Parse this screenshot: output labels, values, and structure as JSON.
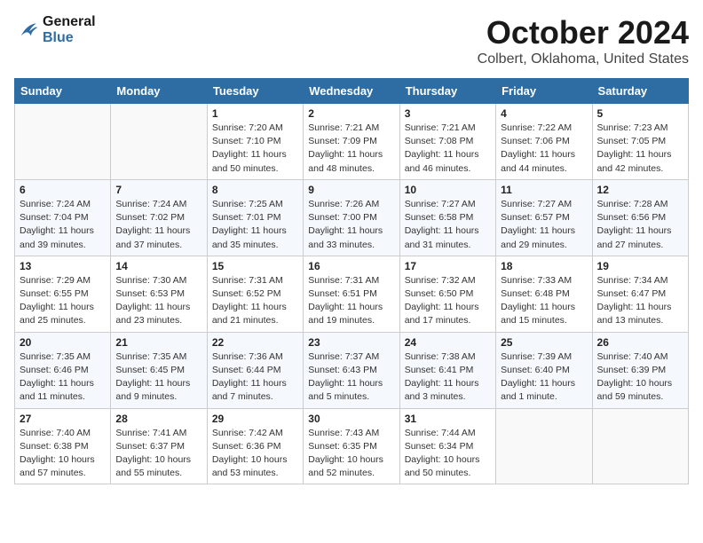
{
  "logo": {
    "line1": "General",
    "line2": "Blue"
  },
  "title": "October 2024",
  "location": "Colbert, Oklahoma, United States",
  "days_of_week": [
    "Sunday",
    "Monday",
    "Tuesday",
    "Wednesday",
    "Thursday",
    "Friday",
    "Saturday"
  ],
  "weeks": [
    [
      {
        "num": "",
        "info": ""
      },
      {
        "num": "",
        "info": ""
      },
      {
        "num": "1",
        "info": "Sunrise: 7:20 AM\nSunset: 7:10 PM\nDaylight: 11 hours and 50 minutes."
      },
      {
        "num": "2",
        "info": "Sunrise: 7:21 AM\nSunset: 7:09 PM\nDaylight: 11 hours and 48 minutes."
      },
      {
        "num": "3",
        "info": "Sunrise: 7:21 AM\nSunset: 7:08 PM\nDaylight: 11 hours and 46 minutes."
      },
      {
        "num": "4",
        "info": "Sunrise: 7:22 AM\nSunset: 7:06 PM\nDaylight: 11 hours and 44 minutes."
      },
      {
        "num": "5",
        "info": "Sunrise: 7:23 AM\nSunset: 7:05 PM\nDaylight: 11 hours and 42 minutes."
      }
    ],
    [
      {
        "num": "6",
        "info": "Sunrise: 7:24 AM\nSunset: 7:04 PM\nDaylight: 11 hours and 39 minutes."
      },
      {
        "num": "7",
        "info": "Sunrise: 7:24 AM\nSunset: 7:02 PM\nDaylight: 11 hours and 37 minutes."
      },
      {
        "num": "8",
        "info": "Sunrise: 7:25 AM\nSunset: 7:01 PM\nDaylight: 11 hours and 35 minutes."
      },
      {
        "num": "9",
        "info": "Sunrise: 7:26 AM\nSunset: 7:00 PM\nDaylight: 11 hours and 33 minutes."
      },
      {
        "num": "10",
        "info": "Sunrise: 7:27 AM\nSunset: 6:58 PM\nDaylight: 11 hours and 31 minutes."
      },
      {
        "num": "11",
        "info": "Sunrise: 7:27 AM\nSunset: 6:57 PM\nDaylight: 11 hours and 29 minutes."
      },
      {
        "num": "12",
        "info": "Sunrise: 7:28 AM\nSunset: 6:56 PM\nDaylight: 11 hours and 27 minutes."
      }
    ],
    [
      {
        "num": "13",
        "info": "Sunrise: 7:29 AM\nSunset: 6:55 PM\nDaylight: 11 hours and 25 minutes."
      },
      {
        "num": "14",
        "info": "Sunrise: 7:30 AM\nSunset: 6:53 PM\nDaylight: 11 hours and 23 minutes."
      },
      {
        "num": "15",
        "info": "Sunrise: 7:31 AM\nSunset: 6:52 PM\nDaylight: 11 hours and 21 minutes."
      },
      {
        "num": "16",
        "info": "Sunrise: 7:31 AM\nSunset: 6:51 PM\nDaylight: 11 hours and 19 minutes."
      },
      {
        "num": "17",
        "info": "Sunrise: 7:32 AM\nSunset: 6:50 PM\nDaylight: 11 hours and 17 minutes."
      },
      {
        "num": "18",
        "info": "Sunrise: 7:33 AM\nSunset: 6:48 PM\nDaylight: 11 hours and 15 minutes."
      },
      {
        "num": "19",
        "info": "Sunrise: 7:34 AM\nSunset: 6:47 PM\nDaylight: 11 hours and 13 minutes."
      }
    ],
    [
      {
        "num": "20",
        "info": "Sunrise: 7:35 AM\nSunset: 6:46 PM\nDaylight: 11 hours and 11 minutes."
      },
      {
        "num": "21",
        "info": "Sunrise: 7:35 AM\nSunset: 6:45 PM\nDaylight: 11 hours and 9 minutes."
      },
      {
        "num": "22",
        "info": "Sunrise: 7:36 AM\nSunset: 6:44 PM\nDaylight: 11 hours and 7 minutes."
      },
      {
        "num": "23",
        "info": "Sunrise: 7:37 AM\nSunset: 6:43 PM\nDaylight: 11 hours and 5 minutes."
      },
      {
        "num": "24",
        "info": "Sunrise: 7:38 AM\nSunset: 6:41 PM\nDaylight: 11 hours and 3 minutes."
      },
      {
        "num": "25",
        "info": "Sunrise: 7:39 AM\nSunset: 6:40 PM\nDaylight: 11 hours and 1 minute."
      },
      {
        "num": "26",
        "info": "Sunrise: 7:40 AM\nSunset: 6:39 PM\nDaylight: 10 hours and 59 minutes."
      }
    ],
    [
      {
        "num": "27",
        "info": "Sunrise: 7:40 AM\nSunset: 6:38 PM\nDaylight: 10 hours and 57 minutes."
      },
      {
        "num": "28",
        "info": "Sunrise: 7:41 AM\nSunset: 6:37 PM\nDaylight: 10 hours and 55 minutes."
      },
      {
        "num": "29",
        "info": "Sunrise: 7:42 AM\nSunset: 6:36 PM\nDaylight: 10 hours and 53 minutes."
      },
      {
        "num": "30",
        "info": "Sunrise: 7:43 AM\nSunset: 6:35 PM\nDaylight: 10 hours and 52 minutes."
      },
      {
        "num": "31",
        "info": "Sunrise: 7:44 AM\nSunset: 6:34 PM\nDaylight: 10 hours and 50 minutes."
      },
      {
        "num": "",
        "info": ""
      },
      {
        "num": "",
        "info": ""
      }
    ]
  ]
}
